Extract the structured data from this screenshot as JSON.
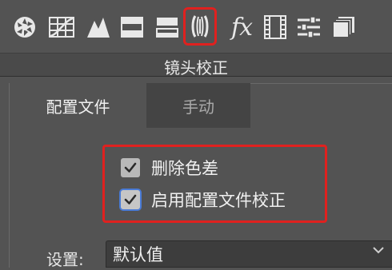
{
  "toolbar": {
    "tools": [
      {
        "name": "basic-aperture-icon"
      },
      {
        "name": "tone-curve-grid-icon"
      },
      {
        "name": "detail-mountain-icon"
      },
      {
        "name": "hsl-bars-icon"
      },
      {
        "name": "split-toning-icon"
      },
      {
        "name": "lens-corrections-icon",
        "active": true
      },
      {
        "name": "fx-effects-icon",
        "label": "fx"
      },
      {
        "name": "calibration-film-icon"
      },
      {
        "name": "presets-sliders-icon"
      },
      {
        "name": "snapshots-icon"
      }
    ],
    "highlight_color": "#e0211f"
  },
  "panel": {
    "title": "镜头校正",
    "tabs": [
      {
        "label": "配置文件",
        "selected": true
      },
      {
        "label": "手动",
        "selected": false
      }
    ],
    "options": [
      {
        "label": "删除色差",
        "checked": true
      },
      {
        "label": "启用配置文件校正",
        "checked": true,
        "focused": true
      }
    ],
    "setting": {
      "label": "设置:",
      "value": "默认值"
    }
  }
}
